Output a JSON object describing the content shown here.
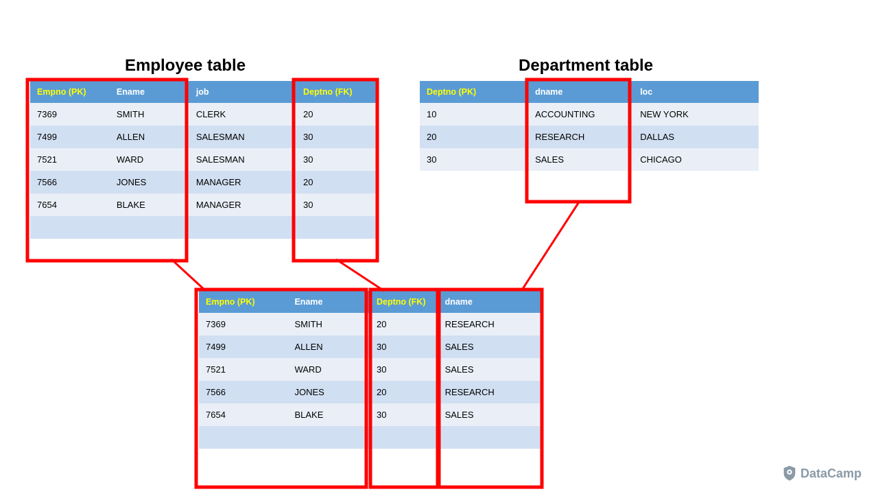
{
  "titles": {
    "employee": "Employee table",
    "department": "Department table"
  },
  "employee": {
    "headers": {
      "empno": "Empno (PK)",
      "ename": "Ename",
      "job": "job",
      "deptno": "Deptno (FK)"
    },
    "rows": [
      {
        "empno": "7369",
        "ename": "SMITH",
        "job": "CLERK",
        "deptno": "20"
      },
      {
        "empno": "7499",
        "ename": "ALLEN",
        "job": "SALESMAN",
        "deptno": "30"
      },
      {
        "empno": "7521",
        "ename": "WARD",
        "job": "SALESMAN",
        "deptno": "30"
      },
      {
        "empno": "7566",
        "ename": "JONES",
        "job": "MANAGER",
        "deptno": "20"
      },
      {
        "empno": "7654",
        "ename": "BLAKE",
        "job": "MANAGER",
        "deptno": "30"
      }
    ]
  },
  "department": {
    "headers": {
      "deptno": "Deptno (PK)",
      "dname": "dname",
      "loc": "loc"
    },
    "rows": [
      {
        "deptno": "10",
        "dname": "ACCOUNTING",
        "loc": "NEW YORK"
      },
      {
        "deptno": "20",
        "dname": "RESEARCH",
        "loc": "DALLAS"
      },
      {
        "deptno": "30",
        "dname": "SALES",
        "loc": "CHICAGO"
      }
    ]
  },
  "joined": {
    "headers": {
      "empno": "Empno (PK)",
      "ename": "Ename",
      "deptno": "Deptno (FK)",
      "dname": "dname"
    },
    "rows": [
      {
        "empno": "7369",
        "ename": "SMITH",
        "deptno": "20",
        "dname": "RESEARCH"
      },
      {
        "empno": "7499",
        "ename": "ALLEN",
        "deptno": "30",
        "dname": "SALES"
      },
      {
        "empno": "7521",
        "ename": "WARD",
        "deptno": "30",
        "dname": "SALES"
      },
      {
        "empno": "7566",
        "ename": "JONES",
        "deptno": "20",
        "dname": "RESEARCH"
      },
      {
        "empno": "7654",
        "ename": "BLAKE",
        "deptno": "30",
        "dname": "SALES"
      }
    ]
  },
  "brand": "DataCamp"
}
